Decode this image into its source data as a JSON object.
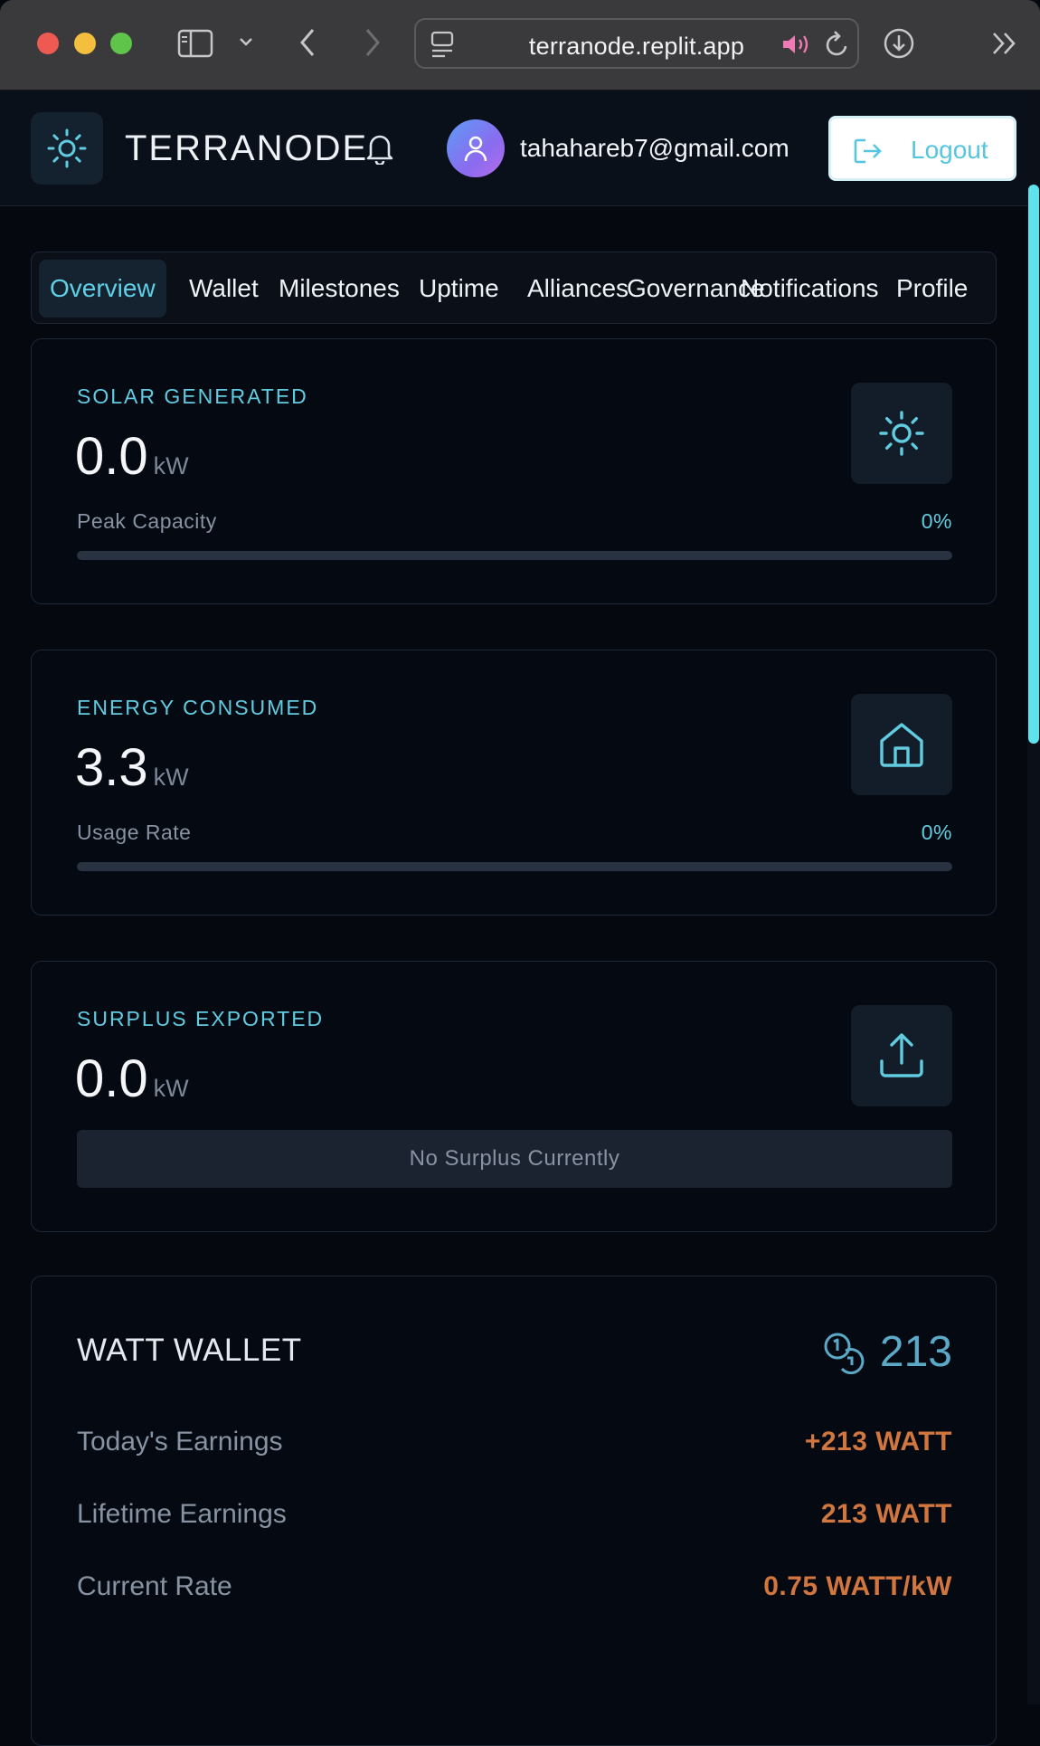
{
  "browser": {
    "url": "terranode.replit.app"
  },
  "header": {
    "brand": "TERRANODE",
    "user_email": "tahahareb7@gmail.com",
    "logout_label": "Logout"
  },
  "tabs": [
    {
      "label": "Overview",
      "active": true
    },
    {
      "label": "Wallet"
    },
    {
      "label": "Milestones"
    },
    {
      "label": "Uptime"
    },
    {
      "label": "Alliances"
    },
    {
      "label": "Governance"
    },
    {
      "label": "Notifications"
    },
    {
      "label": "Profile"
    }
  ],
  "cards": {
    "solar": {
      "label": "SOLAR GENERATED",
      "value": "0.0",
      "unit": "kW",
      "meta_label": "Peak Capacity",
      "percent": "0%",
      "fill_fraction": 0,
      "icon": "sun-icon"
    },
    "energy": {
      "label": "ENERGY CONSUMED",
      "value": "3.3",
      "unit": "kW",
      "meta_label": "Usage Rate",
      "percent": "0%",
      "fill_fraction": 0,
      "icon": "home-icon"
    },
    "surplus": {
      "label": "SURPLUS EXPORTED",
      "value": "0.0",
      "unit": "kW",
      "status": "No Surplus Currently",
      "icon": "upload-icon"
    }
  },
  "wallet": {
    "title": "WATT WALLET",
    "balance": "213",
    "icon": "coins-icon",
    "rows": [
      {
        "label": "Today's Earnings",
        "value": "+213 WATT"
      },
      {
        "label": "Lifetime Earnings",
        "value": "213 WATT"
      },
      {
        "label": "Current Rate",
        "value": "0.75 WATT/kW"
      }
    ]
  },
  "colors": {
    "accent": "#61cbe0",
    "earnings": "#d2763f",
    "background": "#05080f"
  }
}
